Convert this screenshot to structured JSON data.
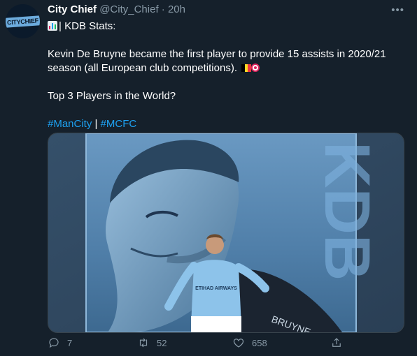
{
  "tweet": {
    "display_name": "City Chief",
    "handle": "@City_Chief",
    "dot": "·",
    "time": "20h",
    "more": "•••",
    "avatar_text": "CITYCHIEF",
    "line1": "| KDB Stats:",
    "line2": "Kevin De Bruyne became the first player to provide 15 assists in 2020/21 season (all European club competitions).",
    "line3": "Top 3 Players in the World?",
    "hashtag1": "#ManCity",
    "separator": " | ",
    "hashtag2": "#MCFC"
  },
  "media": {
    "big_letters": "KDB",
    "shirt_text": "ETIHAD AIRWAYS",
    "jacket_text": "BRUYNE"
  },
  "actions": {
    "replies": "7",
    "retweets": "52",
    "likes": "658"
  },
  "colors": {
    "background": "#15202b",
    "link": "#1da1f2",
    "muted": "#8899a6",
    "border": "#38444d"
  }
}
